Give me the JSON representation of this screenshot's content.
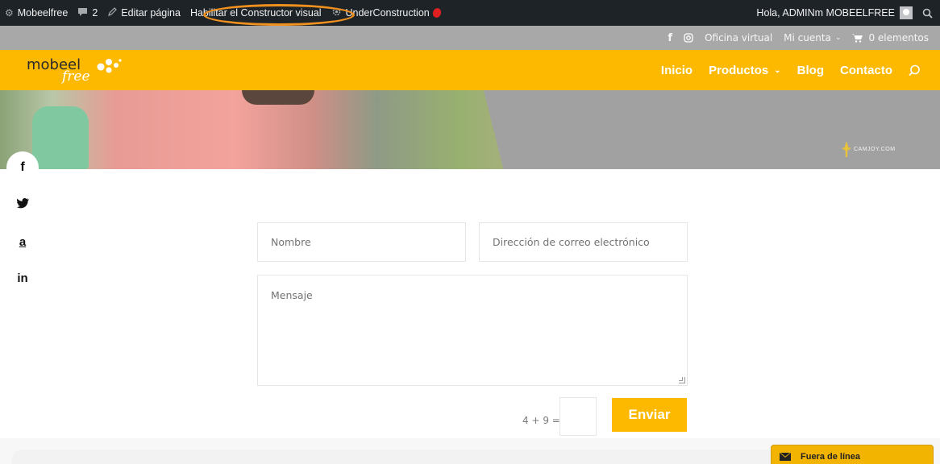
{
  "admin_bar": {
    "site_name": "Mobeelfree",
    "comments_count": "2",
    "edit_page": "Editar página",
    "visual_builder": "Habilitar el Constructor visual",
    "under_construction": "UnderConstruction",
    "greeting": "Hola, ADMINm MOBEELFREE"
  },
  "top_bar": {
    "facebook": "f",
    "virtual_office": "Oficina virtual",
    "my_account": "Mi cuenta",
    "cart": "0 elementos"
  },
  "header": {
    "logo_word": "mobeel",
    "logo_script": "free",
    "nav": [
      "Inicio",
      "Productos",
      "Blog",
      "Contacto"
    ]
  },
  "hero": {
    "watermark": "CAMJOY.COM"
  },
  "social": {
    "facebook": "f",
    "amazon": "a",
    "linkedin": "in"
  },
  "form": {
    "name_placeholder": "Nombre",
    "email_placeholder": "Dirección de correo electrónico",
    "message_placeholder": "Mensaje",
    "captcha_question": "4 + 9 =",
    "submit_label": "Enviar"
  },
  "chat": {
    "status": "Fuera de línea"
  },
  "colors": {
    "brand_yellow": "#fcb900",
    "admin_bar": "#1d2327",
    "top_bar": "#a8a8a8"
  }
}
